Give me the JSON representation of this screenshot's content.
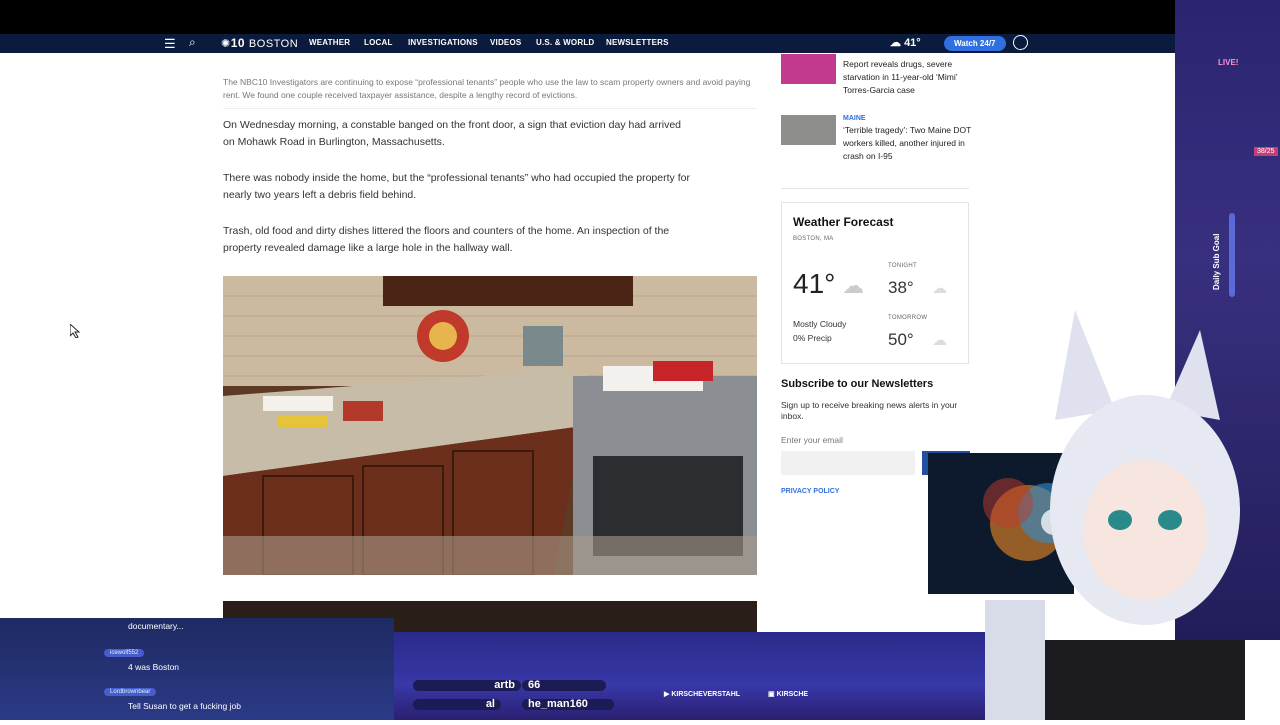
{
  "nav": {
    "logo_num": "10",
    "logo_text": "BOSTON",
    "items": [
      "WEATHER",
      "LOCAL",
      "INVESTIGATIONS",
      "VIDEOS",
      "U.S. & WORLD",
      "NEWSLETTERS"
    ],
    "temperature": "41°",
    "watch_label": "Watch 24/7"
  },
  "article": {
    "caption": "The NBC10 Investigators are continuing to expose “professional tenants” people who use the law to scam property owners and avoid paying rent. We found one couple received taxpayer assistance, despite a lengthy record of evictions.",
    "paragraphs": [
      "On Wednesday morning, a constable banged on the front door, a sign that eviction day had arrived on Mohawk Road in Burlington, Massachusetts.",
      "There was nobody inside the home, but the “professional tenants” who had occupied the property for nearly two years left a debris field behind.",
      "Trash, old food and dirty dishes littered the floors and counters of the home. An inspection of the property revealed damage like a large hole in the hallway wall."
    ]
  },
  "sidebar": {
    "stories": [
      {
        "tag": "",
        "title": "Report reveals drugs, severe starvation in 11-year-old ‘Mimi’ Torres-Garcia case"
      },
      {
        "tag": "MAINE",
        "title": "‘Terrible tragedy’: Two Maine DOT workers killed, another injured in crash on I-95"
      }
    ],
    "weather": {
      "title": "Weather Forecast",
      "location": "BOSTON, MA",
      "current_temp": "41°",
      "condition": "Mostly Cloudy",
      "precip": "0% Precip",
      "tonight_label": "TONIGHT",
      "tonight_temp": "38°",
      "tomorrow_label": "TOMORROW",
      "tomorrow_temp": "50°"
    },
    "newsletter": {
      "title": "Subscribe to our Newsletters",
      "description": "Sign up to receive breaking news alerts in your inbox.",
      "email_label": "Enter your email",
      "privacy": "PRIVACY POLICY"
    }
  },
  "stream": {
    "live": "LIVE!",
    "subgoal": "Daily Sub Goal",
    "subcount": "38/25",
    "chat": [
      {
        "user": "",
        "text": "documentary..."
      },
      {
        "user": "icewolf552",
        "text": "4 was Boston"
      },
      {
        "user": "Lordbrownbear",
        "text": "Tell Susan to get a fucking job"
      }
    ],
    "ticker": [
      "artb",
      "66",
      "al",
      "he_man160"
    ],
    "socials": [
      "KIRSCHEVERSTAHL",
      "KIRSCHE"
    ]
  }
}
